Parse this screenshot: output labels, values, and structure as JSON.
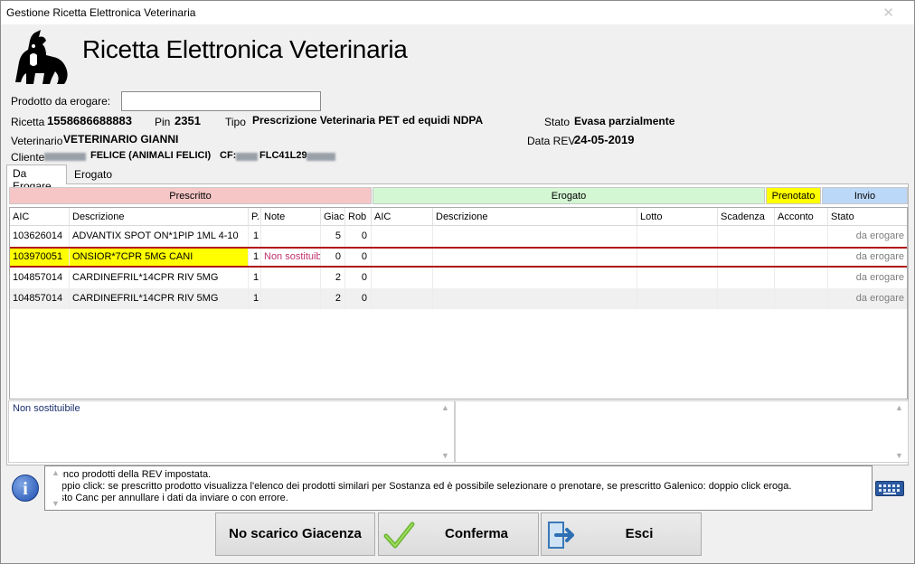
{
  "window": {
    "title": "Gestione Ricetta Elettronica Veterinaria",
    "close_glyph": "✕"
  },
  "header": {
    "app_title": "Ricetta Elettronica Veterinaria",
    "logo_icon": "dog-cat-logo"
  },
  "form": {
    "prodotto_label": "Prodotto da erogare:",
    "prodotto_value": "",
    "ricetta_label": "Ricetta",
    "ricetta_value": "1558686688883",
    "pin_label": "Pin",
    "pin_value": "2351",
    "tipo_label": "Tipo",
    "tipo_value": "Prescrizione Veterinaria PET ed equidi NDPA",
    "stato_label": "Stato",
    "stato_value": "Evasa parzialmente",
    "veterinario_label": "Veterinario",
    "veterinario_value": "VETERINARIO GIANNI",
    "datarev_label": "Data REV",
    "datarev_value": "24-05-2019",
    "cliente_label": "Cliente",
    "cliente_name": "FELICE  (ANIMALI FELICI)",
    "cliente_cf_label": "CF:",
    "cliente_cf_value": "FLC41L29"
  },
  "tabs": [
    {
      "label": "Da Erogare",
      "active": true
    },
    {
      "label": "Erogato",
      "active": false
    }
  ],
  "sections": {
    "prescritto": {
      "label": "Prescritto",
      "color": "#f6c6c6"
    },
    "erogato": {
      "label": "Erogato",
      "color": "#d3f7d3"
    },
    "prenotato": {
      "label": "Prenotato",
      "color": "#ffff00"
    },
    "invio": {
      "label": "Invio",
      "color": "#bcd8f8"
    }
  },
  "grid": {
    "headers": [
      "AIC",
      "Descrizione",
      "P.",
      "Note",
      "Giac",
      "Rob",
      "AIC",
      "Descrizione",
      "Lotto",
      "Scadenza",
      "Acconto",
      "Stato"
    ],
    "rows": [
      {
        "aic": "103626014",
        "descrizione": "ADVANTIX SPOT ON*1PIP 1ML 4-10",
        "p": "1",
        "note": "",
        "giac": "5",
        "rob": "0",
        "stato": "da erogare"
      },
      {
        "aic": "103970051",
        "descrizione": "ONSIOR*7CPR 5MG CANI",
        "p": "1",
        "note": "Non sostituib",
        "giac": "0",
        "rob": "0",
        "stato": "da erogare"
      },
      {
        "aic": "104857014",
        "descrizione": "CARDINEFRIL*14CPR RIV 5MG",
        "p": "1",
        "note": "",
        "giac": "2",
        "rob": "0",
        "stato": "da erogare"
      },
      {
        "aic": "104857014",
        "descrizione": "CARDINEFRIL*14CPR RIV 5MG",
        "p": "1",
        "note": "",
        "giac": "2",
        "rob": "0",
        "stato": "da erogare"
      }
    ],
    "selected_color": "#ffff00",
    "selected_border": "#b01818"
  },
  "note_text": "Non sostituibile",
  "info": {
    "line1": "Elenco prodotti della REV impostata.",
    "line2": "Doppio click: se prescritto prodotto visualizza l'elenco dei prodotti similari per Sostanza ed è possibile selezionare o prenotare, se prescritto Galenico: doppio click eroga.",
    "line3": "Tasto Canc per annullare i dati da inviare o con errore.",
    "icon": "info-icon"
  },
  "buttons": {
    "no_scarico": "No scarico Giacenza",
    "conferma": "Conferma",
    "esci": "Esci"
  }
}
